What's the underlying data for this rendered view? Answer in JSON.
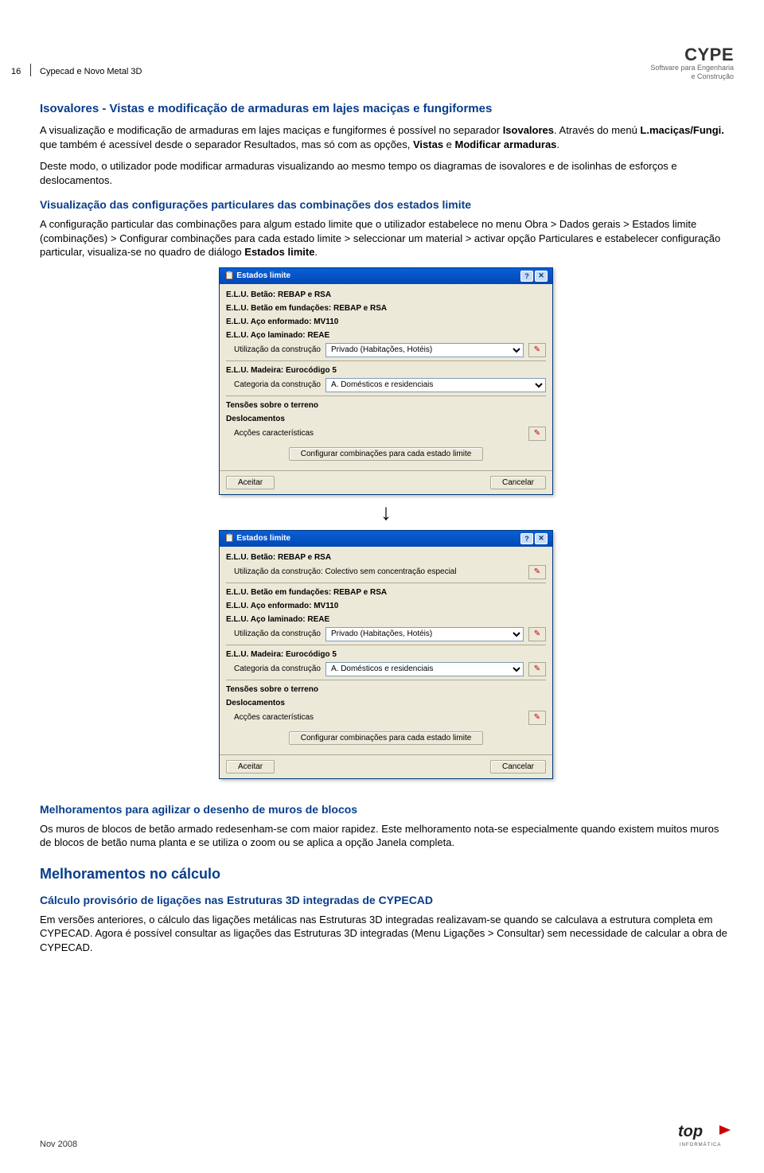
{
  "page_number": "16",
  "header_doc_title": "Cypecad e Novo Metal 3D",
  "brand": {
    "name": "CYPE",
    "tagline1": "Software para Engenharia",
    "tagline2": "e Construção"
  },
  "sec1": {
    "title": "Isovalores - Vistas e modificação de armaduras em lajes maciças e fungiformes",
    "p1_a": "A visualização e modificação de armaduras em lajes maciças e fungiformes é possível no separador ",
    "p1_b": "Isovalores",
    "p1_c": ". Através do menú ",
    "p1_d": "L.maciças/Fungi.",
    "p1_e": " que também é acessível desde o separador Resultados, mas só com as opções, ",
    "p1_f": "Vistas",
    "p1_g": " e ",
    "p1_h": "Modificar armaduras",
    "p1_i": ".",
    "p2": "Deste modo, o utilizador pode modificar armaduras visualizando ao mesmo tempo os diagramas de isovalores e de isolinhas de esforços e deslocamentos."
  },
  "sec2": {
    "title": "Visualização das configurações particulares das combinações dos estados limite",
    "p1_a": "A configuração particular das combinações para algum estado limite que o utilizador estabelece no menu Obra > Dados gerais > Estados limite (combinações) > Configurar combinações para cada estado limite > seleccionar um material > activar opção Particulares e estabelecer configuração particular, visualiza-se no quadro de diálogo ",
    "p1_b": "Estados limite",
    "p1_c": "."
  },
  "dialog1": {
    "title": "Estados limite",
    "lines": [
      "E.L.U. Betão: REBAP e RSA",
      "E.L.U. Betão em fundações: REBAP e RSA",
      "E.L.U. Aço enformado: MV110",
      "E.L.U. Aço laminado: REAE"
    ],
    "row_util_label": "Utilização da construção",
    "row_util_value": "Privado (Habitações, Hotéis)",
    "hdr_madeira": "E.L.U. Madeira: Eurocódigo 5",
    "row_cat_label": "Categoria da construção",
    "row_cat_value": "A. Domésticos e residenciais",
    "hdr_tensoes": "Tensões sobre o terreno",
    "hdr_desloc": "Deslocamentos",
    "row_accoes": "Acções características",
    "btn_config": "Configurar combinações para cada estado limite",
    "btn_aceitar": "Aceitar",
    "btn_cancelar": "Cancelar"
  },
  "dialog2": {
    "title": "Estados limite",
    "hdr_betao": "E.L.U. Betão: REBAP e RSA",
    "row_util_top": "Utilização da construção: Colectivo sem concentração especial",
    "lines": [
      "E.L.U. Betão em fundações: REBAP e RSA",
      "E.L.U. Aço enformado: MV110",
      "E.L.U. Aço laminado: REAE"
    ],
    "row_util_label": "Utilização da construção",
    "row_util_value": "Privado (Habitações, Hotéis)",
    "hdr_madeira": "E.L.U. Madeira: Eurocódigo 5",
    "row_cat_label": "Categoria da construção",
    "row_cat_value": "A. Domésticos e residenciais",
    "hdr_tensoes": "Tensões sobre o terreno",
    "hdr_desloc": "Deslocamentos",
    "row_accoes": "Acções características",
    "btn_config": "Configurar combinações para cada estado limite",
    "btn_aceitar": "Aceitar",
    "btn_cancelar": "Cancelar"
  },
  "sec3": {
    "title": "Melhoramentos para agilizar o desenho de muros de blocos",
    "p1": "Os muros de blocos de betão armado redesenham-se com maior rapidez. Este melhoramento nota-se especialmente quando existem muitos muros de blocos de betão numa planta e se utiliza o zoom ou se aplica a opção Janela completa."
  },
  "sec4": {
    "title": "Melhoramentos no cálculo",
    "sub_title": "Cálculo provisório de ligações nas Estruturas 3D integradas de CYPECAD",
    "p1": "Em versões anteriores, o cálculo das ligações metálicas nas Estruturas 3D integradas realizavam-se quando se calculava a estrutura completa em CYPECAD. Agora é possível consultar as ligações das Estruturas 3D integradas (Menu Ligações > Consultar) sem necessidade de calcular a obra de CYPECAD."
  },
  "footer_date": "Nov 2008",
  "footer_brand": "top",
  "footer_brand_sub": "INFORMÁTICA"
}
